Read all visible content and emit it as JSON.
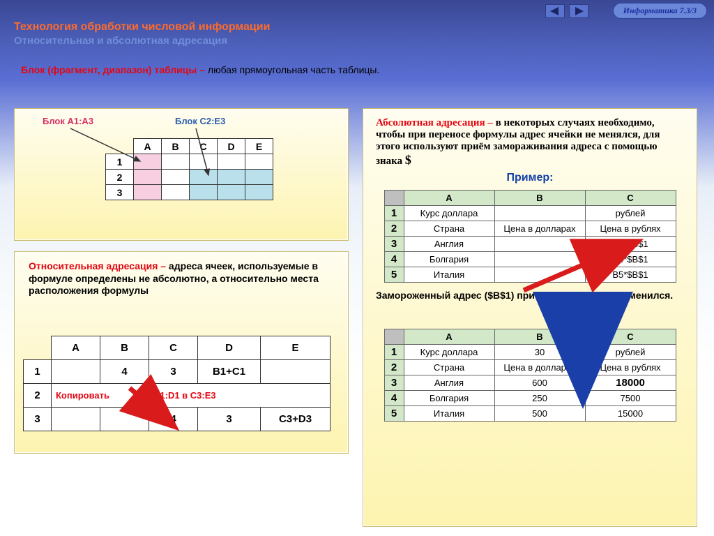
{
  "badge": "Информатика  7.3/3",
  "header": {
    "line1": "Технология обработки числовой информации",
    "line2": "Относительная и абсолютная адресация"
  },
  "intro": {
    "bold": "Блок (фрагмент, диапазон) таблицы – ",
    "rest": "любая прямоугольная часть таблицы."
  },
  "blocks_panel": {
    "label_a": "Блок A1:A3",
    "label_c": "Блок C2:E3",
    "cols": [
      "A",
      "B",
      "C",
      "D",
      "E"
    ],
    "rows": [
      "1",
      "2",
      "3"
    ]
  },
  "rel_panel": {
    "title": "Относительная адресация – ",
    "body": "адреса ячеек, используемые в формуле определены не абсолютно, а относительно места расположения формулы",
    "cols": [
      "A",
      "B",
      "C",
      "D",
      "E"
    ],
    "rows": [
      "1",
      "2",
      "3"
    ],
    "r1": [
      "",
      "4",
      "3",
      "B1+C1",
      ""
    ],
    "r2_copy": "Копировать",
    "r2_formula": "B1:D1 в C3:E3",
    "r3": [
      "",
      "",
      "4",
      "3",
      "C3+D3"
    ]
  },
  "abs_panel": {
    "para_bold": "Абсолютная адресация – ",
    "para_body": "в некоторых случаях необходимо, чтобы при переносе формулы адрес ячейки не менялся, для этого используют приём замораживания адреса с помощью знака ",
    "dollar": "$",
    "example": "Пример:",
    "cols": [
      "A",
      "B",
      "C"
    ],
    "rows": [
      "1",
      "2",
      "3",
      "4",
      "5"
    ],
    "t1": [
      [
        "Курс доллара",
        "",
        "рублей"
      ],
      [
        "Страна",
        "Цена в долларах",
        "Цена в рублях"
      ],
      [
        "Англия",
        "",
        "B3*$B$1"
      ],
      [
        "Болгария",
        "",
        "B4*$B$1"
      ],
      [
        "Италия",
        "",
        "B5*$B$1"
      ]
    ],
    "note": "Замороженный адрес ($B$1) при копировании не изменился.",
    "t2": [
      [
        "Курс доллара",
        "30",
        "рублей"
      ],
      [
        "Страна",
        "Цена в долларах",
        "Цена в рублях"
      ],
      [
        "Англия",
        "600",
        "18000"
      ],
      [
        "Болгария",
        "250",
        "7500"
      ],
      [
        "Италия",
        "500",
        "15000"
      ]
    ]
  }
}
